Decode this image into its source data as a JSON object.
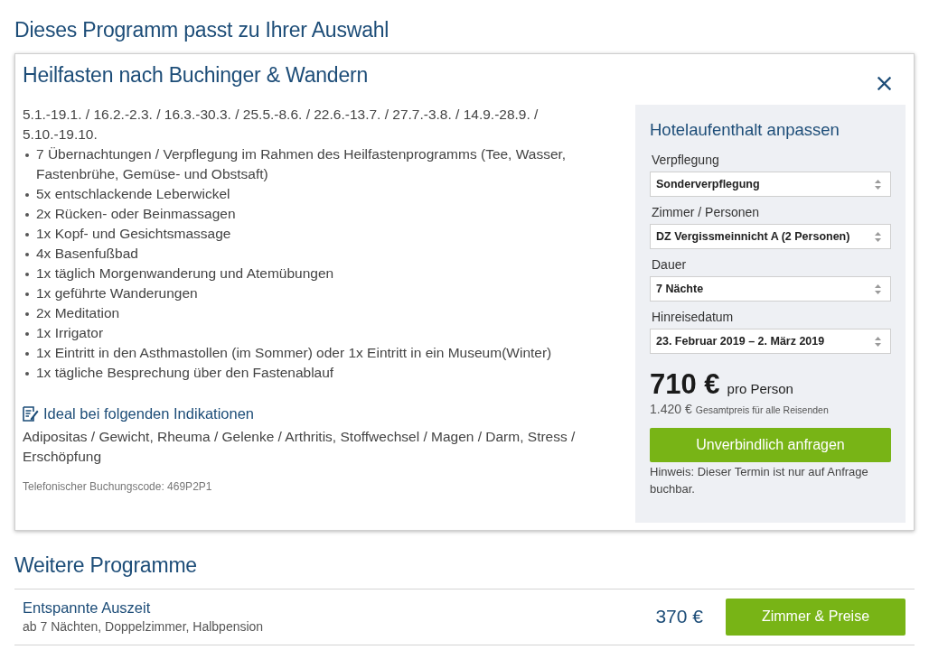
{
  "heading": "Dieses Programm passt zu Ihrer Auswahl",
  "program": {
    "title": "Heilfasten nach Buchinger & Wandern",
    "dates": "5.1.-19.1. / 16.2.-2.3. / 16.3.-30.3. / 25.5.-8.6. / 22.6.-13.7. / 27.7.-3.8. / 14.9.-28.9. / 5.10.-19.10.",
    "features": [
      "7 Übernachtungen / Verpflegung im Rahmen des Heilfastenprogramms (Tee, Wasser, Fastenbrühe, Gemüse- und Obstsaft)",
      "5x entschlackende Leberwickel",
      "2x Rücken- oder Beinmassagen",
      "1x Kopf- und Gesichtsmassage",
      "4x Basenfußbad",
      "1x täglich Morgenwanderung und Atemübungen",
      "1x geführte Wanderungen",
      "2x Meditation",
      "1x Irrigator",
      "1x Eintritt in den Asthmastollen (im Sommer) oder 1x Eintritt in ein Museum(Winter)",
      "1x tägliche Besprechung über den Fastenablauf"
    ],
    "indications": {
      "title": "Ideal bei folgenden Indikationen",
      "text": "Adipositas / Gewicht, Rheuma / Gelenke / Arthritis, Stoffwechsel / Magen / Darm, Stress / Erschöpfung"
    },
    "booking_code": "Telefonischer Buchungscode: 469P2P1"
  },
  "customize": {
    "title": "Hotelaufenthalt anpassen",
    "fields": [
      {
        "label": "Verpflegung",
        "value": "Sonderverpflegung"
      },
      {
        "label": "Zimmer / Personen",
        "value": "DZ Vergissmeinnicht A (2 Personen)"
      },
      {
        "label": "Dauer",
        "value": "7 Nächte"
      },
      {
        "label": "Hinreisedatum",
        "value": "23. Februar 2019 – 2. März 2019"
      }
    ],
    "price": "710 €",
    "price_unit": "pro Person",
    "total": "1.420 €",
    "total_label": "Gesamtpreis für alle Reisenden",
    "button": "Unverbindlich anfragen",
    "note": "Hinweis: Dieser Termin ist nur auf Anfrage buchbar."
  },
  "more": {
    "title": "Weitere Programme",
    "items": [
      {
        "title": "Entspannte Auszeit",
        "subtitle": "ab 7 Nächten, Doppelzimmer, Halbpension",
        "price": "370 €",
        "button": "Zimmer & Preise"
      }
    ]
  }
}
